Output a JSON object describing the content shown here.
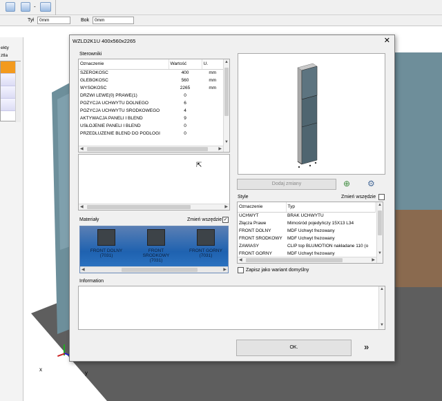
{
  "toolbar": {
    "tyl_label": "Tył",
    "tyl_value": "0mm",
    "bok_label": "Bok",
    "bok_value": "0mm"
  },
  "left_panel": {
    "row1": "ekty",
    "row2": "ztla"
  },
  "dialog": {
    "title": "WZLD2K1U 400x560x2265",
    "close": "✕",
    "sterowniki": {
      "label": "Sterowniki",
      "headers": [
        "Oznaczenie",
        "Wartość",
        "U."
      ],
      "rows": [
        [
          "SZEROKOSC",
          "400",
          "mm"
        ],
        [
          "GLEBOKOSC",
          "560",
          "mm"
        ],
        [
          "WYSOKOSC",
          "2265",
          "mm"
        ],
        [
          "DRZWI LEWE(0)  PRAWE(1)",
          "0",
          ""
        ],
        [
          "POZYCJA UCHWYTU DOLNEGO",
          "6",
          ""
        ],
        [
          "POZYCJA UCHWYTU SRODKOWEGO",
          "4",
          ""
        ],
        [
          "AKTYWACJA PANELI I BLEND",
          "9",
          ""
        ],
        [
          "USŁOJENIE PANELI I BLEND",
          "0",
          ""
        ],
        [
          "PRZEDLUZENIE BLEND DO PODLOGI",
          "0",
          ""
        ]
      ]
    },
    "materialy": {
      "label": "Materiały",
      "zmien_label": "Zmień wszędzie",
      "items": [
        {
          "name": "FRONT DOLNY",
          "code": "(7031)"
        },
        {
          "name": "FRONT SRODKOWY",
          "code": "(7031)"
        },
        {
          "name": "FRONT GORNY",
          "code": "(7031)"
        }
      ]
    },
    "dodaj_label": "Dodaj zmiany",
    "style": {
      "label": "Style",
      "zmien_label": "Zmień wszędzie",
      "headers": [
        "Oznaczenie",
        "Typ"
      ],
      "rows": [
        [
          "UCHWYT",
          "BRAK UCHWYTU"
        ],
        [
          "Złącza Prawe",
          "Mimośród pojedyńczy 15X13 L34"
        ],
        [
          "FRONT DOLNY",
          "MDF Uchwyt frezowany"
        ],
        [
          "FRONT SRODKOWY",
          "MDF Uchwyt frezowany"
        ],
        [
          "ZAWIASY",
          "CLIP top BLUMOTION nakładane 110 (o"
        ],
        [
          "FRONT GORNY",
          "MDF Uchwyt frezowany"
        ]
      ]
    },
    "zapisz_label": "Zapisz jako wariant domyślny",
    "information_label": "Information",
    "ok_label": "OK."
  },
  "axes": {
    "x": "x",
    "y": "y"
  },
  "colors": {
    "materials_bg": "#1f62b0",
    "selected_left": "#f39a1e",
    "cabinet": "#6f8f9c"
  }
}
